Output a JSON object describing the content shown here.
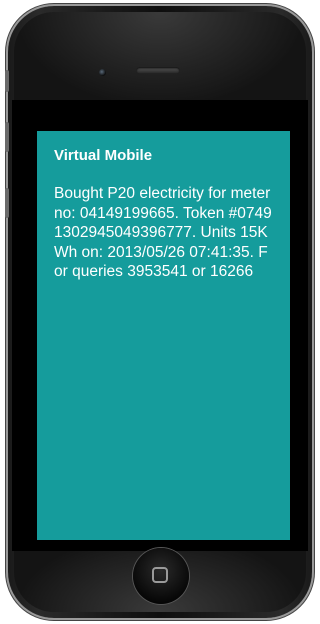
{
  "message": {
    "sender": "Virtual Mobile",
    "body": "Bought P20 electricity for  meter no: 04149199665. Token #07491302945049396777. Units  15KWh on: 2013/05/26 07:41:35. For queries 3953541 or 16266"
  },
  "colors": {
    "screen_background": "#159c9c",
    "text": "#ffffff",
    "phone_body": "#111111"
  },
  "icons": {
    "camera": "front-camera-icon",
    "speaker": "earpiece-speaker-icon",
    "home": "home-button-icon"
  }
}
